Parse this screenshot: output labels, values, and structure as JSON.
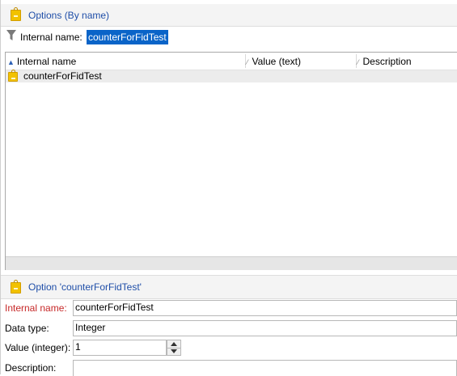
{
  "list_panel": {
    "title": "Options (By name)",
    "filter": {
      "label": "Internal name:",
      "value": "counterForFidTest"
    },
    "columns": [
      {
        "label": "Internal name",
        "sort_mark": "▲"
      },
      {
        "label": "Value (text)",
        "sort_mark": "⁄"
      },
      {
        "label": "Description",
        "sort_mark": "⁄"
      }
    ],
    "rows": [
      {
        "name": "counterForFidTest",
        "value": "",
        "description": ""
      }
    ]
  },
  "detail_panel": {
    "title": "Option 'counterForFidTest'",
    "fields": {
      "internal_name": {
        "label": "Internal name:",
        "value": "counterForFidTest"
      },
      "data_type": {
        "label": "Data type:",
        "value": "Integer"
      },
      "value_integer": {
        "label": "Value (integer):",
        "value": "1"
      },
      "description": {
        "label": "Description:",
        "value": ""
      }
    }
  },
  "colors": {
    "required_label": "#c62828",
    "title_blue": "#1f4ea8",
    "selection": "#0a64c8"
  }
}
